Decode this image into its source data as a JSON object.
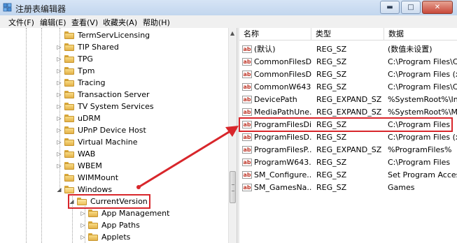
{
  "window": {
    "title": "注册表编辑器"
  },
  "menu": [
    {
      "label": "文件(F)"
    },
    {
      "label": "编辑(E)"
    },
    {
      "label": "查看(V)"
    },
    {
      "label": "收藏夹(A)"
    },
    {
      "label": "帮助(H)"
    }
  ],
  "tree": [
    {
      "label": "TermServLicensing"
    },
    {
      "label": "TIP Shared"
    },
    {
      "label": "TPG"
    },
    {
      "label": "Tpm"
    },
    {
      "label": "Tracing"
    },
    {
      "label": "Transaction Server"
    },
    {
      "label": "TV System Services"
    },
    {
      "label": "uDRM"
    },
    {
      "label": "UPnP Device Host"
    },
    {
      "label": "Virtual Machine"
    },
    {
      "label": "WAB"
    },
    {
      "label": "WBEM"
    },
    {
      "label": "WIMMount"
    },
    {
      "label": "Windows"
    },
    {
      "label": "CurrentVersion"
    },
    {
      "label": "App Management"
    },
    {
      "label": "App Paths"
    },
    {
      "label": "Applets"
    }
  ],
  "columns": {
    "name": "名称",
    "type": "类型",
    "data": "数据"
  },
  "values": [
    {
      "name": "(默认)",
      "type": "REG_SZ",
      "data": "(数值未设置)"
    },
    {
      "name": "CommonFilesDir",
      "type": "REG_SZ",
      "data": "C:\\Program Files\\Co"
    },
    {
      "name": "CommonFilesD...",
      "type": "REG_SZ",
      "data": "C:\\Program Files (x8"
    },
    {
      "name": "CommonW643...",
      "type": "REG_SZ",
      "data": "C:\\Program Files\\Co"
    },
    {
      "name": "DevicePath",
      "type": "REG_EXPAND_SZ",
      "data": "%SystemRoot%\\Inf"
    },
    {
      "name": "MediaPathUne...",
      "type": "REG_EXPAND_SZ",
      "data": "%SystemRoot%\\Me"
    },
    {
      "name": "ProgramFilesDir",
      "type": "REG_SZ",
      "data": "C:\\Program Files"
    },
    {
      "name": "ProgramFilesD...",
      "type": "REG_SZ",
      "data": "C:\\Program Files (x8"
    },
    {
      "name": "ProgramFilesP...",
      "type": "REG_EXPAND_SZ",
      "data": "%ProgramFiles%"
    },
    {
      "name": "ProgramW643...",
      "type": "REG_SZ",
      "data": "C:\\Program Files"
    },
    {
      "name": "SM_Configure...",
      "type": "REG_SZ",
      "data": "Set Program Access"
    },
    {
      "name": "SM_GamesNa...",
      "type": "REG_SZ",
      "data": "Games"
    }
  ],
  "icons": {
    "app": "registry-editor-icon",
    "folder": "folder-icon",
    "value": "string-value-icon",
    "expander": "chevron-right-icon"
  },
  "colors": {
    "highlight": "#d8262b"
  }
}
